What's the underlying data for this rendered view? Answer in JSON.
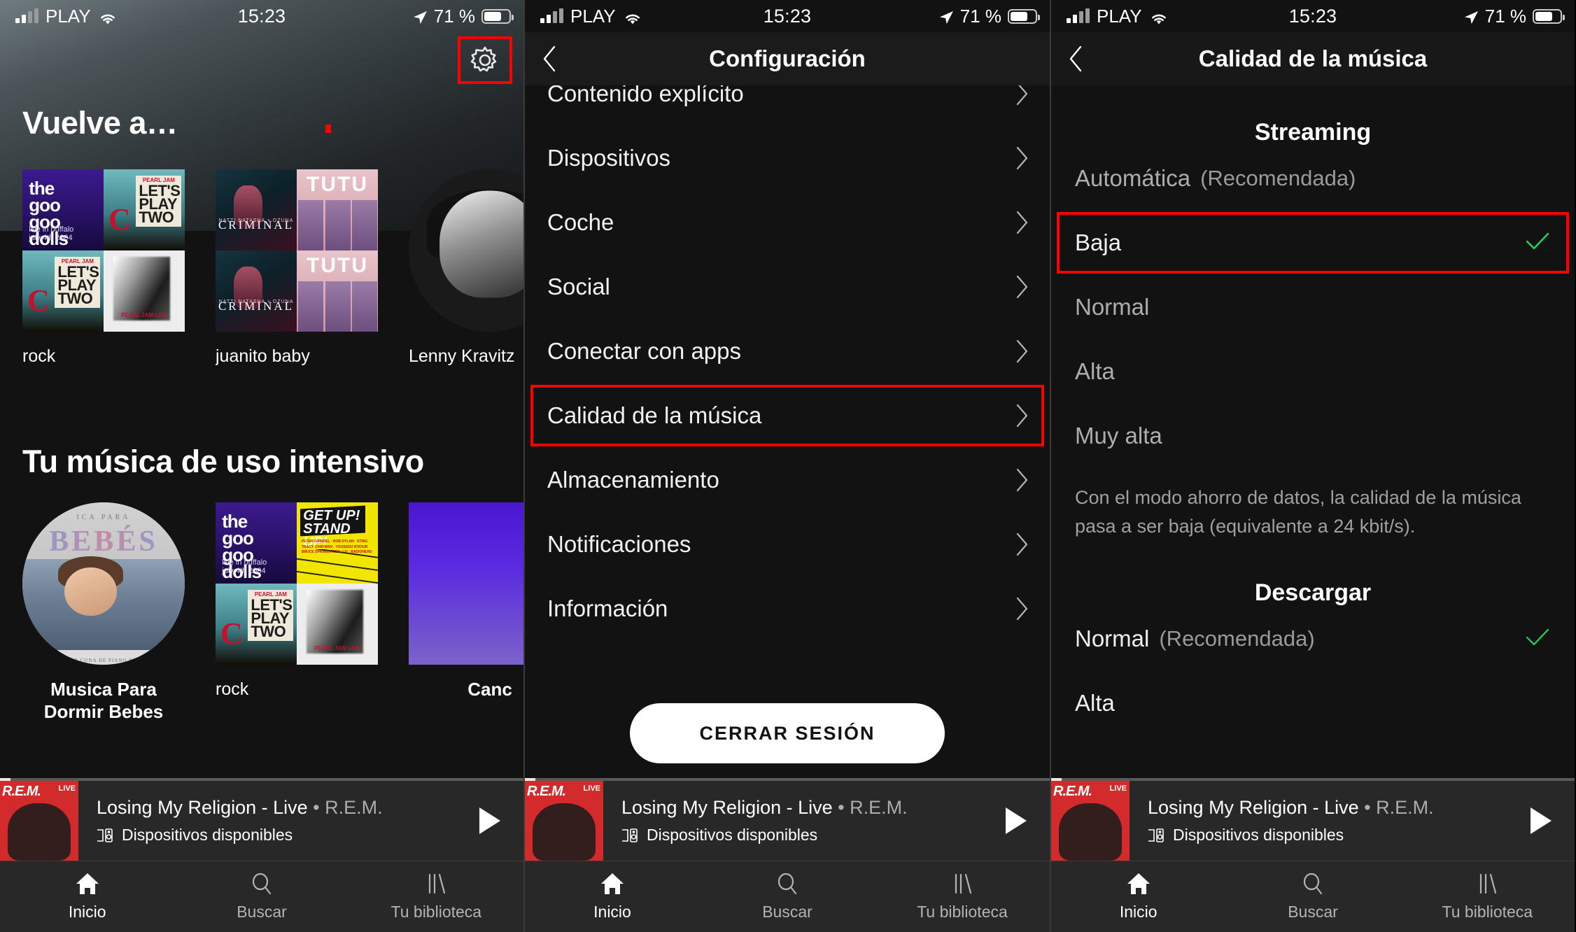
{
  "status_bar": {
    "carrier": "PLAY",
    "time": "15:23",
    "battery_percent": "71 %",
    "signal_icon": "signal-bars-icon",
    "wifi_icon": "wifi-icon",
    "location_icon": "location-arrow-icon",
    "battery_icon": "battery-icon"
  },
  "panel1": {
    "gear_icon": "gear-icon",
    "sections": [
      {
        "title": "Vuelve a…",
        "cards": [
          {
            "label": "rock",
            "art": "quad-goo-play"
          },
          {
            "label": "juanito baby",
            "art": "quad-criminal-tutu"
          },
          {
            "label": "Lenny Kravitz",
            "art": "lenny-circle"
          }
        ]
      },
      {
        "title": "Tu música de uso intensivo",
        "cards": [
          {
            "label": "Musica Para Dormir Bebes",
            "art": "bebes-circle"
          },
          {
            "label": "rock",
            "art": "quad-rock"
          },
          {
            "label": "Canc",
            "art": "purple"
          }
        ]
      }
    ]
  },
  "panel2": {
    "nav_title": "Configuración",
    "back_icon": "chevron-left-icon",
    "items": [
      {
        "label": "Contenido explícito",
        "chevron": "chevron-right-icon",
        "highlighted": false,
        "clipped": true
      },
      {
        "label": "Dispositivos",
        "chevron": "chevron-right-icon",
        "highlighted": false
      },
      {
        "label": "Coche",
        "chevron": "chevron-right-icon",
        "highlighted": false
      },
      {
        "label": "Social",
        "chevron": "chevron-right-icon",
        "highlighted": false
      },
      {
        "label": "Conectar con apps",
        "chevron": "chevron-right-icon",
        "highlighted": false
      },
      {
        "label": "Calidad de la música",
        "chevron": "chevron-right-icon",
        "highlighted": true
      },
      {
        "label": "Almacenamiento",
        "chevron": "chevron-right-icon",
        "highlighted": false
      },
      {
        "label": "Notificaciones",
        "chevron": "chevron-right-icon",
        "highlighted": false
      },
      {
        "label": "Información",
        "chevron": "chevron-right-icon",
        "highlighted": false
      }
    ],
    "logout_label": "CERRAR SESIÓN"
  },
  "panel3": {
    "nav_title": "Calidad de la música",
    "back_icon": "chevron-left-icon",
    "streaming": {
      "heading": "Streaming",
      "options": [
        {
          "label": "Automática",
          "suffix": "(Recomendada)",
          "selected": false,
          "highlighted": false
        },
        {
          "label": "Baja",
          "suffix": "",
          "selected": true,
          "highlighted": true
        },
        {
          "label": "Normal",
          "suffix": "",
          "selected": false,
          "highlighted": false
        },
        {
          "label": "Alta",
          "suffix": "",
          "selected": false,
          "highlighted": false
        },
        {
          "label": "Muy alta",
          "suffix": "",
          "selected": false,
          "highlighted": false
        }
      ],
      "note": "Con el modo ahorro de datos, la calidad de la música pasa a ser baja (equivalente a 24 kbit/s)."
    },
    "download": {
      "heading": "Descargar",
      "options": [
        {
          "label": "Normal",
          "suffix": "(Recomendada)",
          "selected": true,
          "highlighted": false
        },
        {
          "label": "Alta",
          "suffix": "",
          "selected": false,
          "highlighted": false
        }
      ]
    },
    "check_icon": "checkmark-icon",
    "check_color": "#1ed760"
  },
  "now_playing": {
    "title": "Losing My Religion - Live",
    "separator": " • ",
    "artist": "R.E.M.",
    "devices_label": "Dispositivos disponibles",
    "devices_icon": "connect-device-icon",
    "play_icon": "play-icon",
    "art_text": "R.E.M.",
    "art_badge": "LIVE"
  },
  "tabbar": {
    "tabs": [
      {
        "label": "Inicio",
        "icon": "home-icon",
        "active": true
      },
      {
        "label": "Buscar",
        "icon": "search-icon",
        "active": false
      },
      {
        "label": "Tu biblioteca",
        "icon": "library-icon",
        "active": false
      }
    ]
  },
  "highlight_color": "#fe0000"
}
